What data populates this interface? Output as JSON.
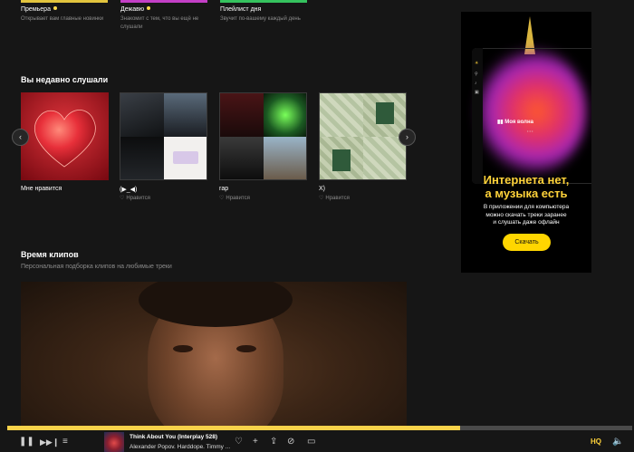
{
  "top_cards": [
    {
      "title": "Премьера",
      "subtitle": "Открывает вам главные новинки",
      "bar_color": "#ffdb4d"
    },
    {
      "title": "Дежавю",
      "subtitle": "Знакомит с тем, что вы ещё не слушали",
      "bar_color": "#d94ad8"
    },
    {
      "title": "Плейлист дня",
      "subtitle": "Звучит по-вашему каждый день",
      "bar_color": "#3fd66b"
    }
  ],
  "recent": {
    "title": "Вы недавно слушали",
    "items": [
      {
        "title": "Мне нравится",
        "like": ""
      },
      {
        "title": "(▶︎_◀)",
        "like": "Нравится"
      },
      {
        "title": "rap",
        "like": "Нравится"
      },
      {
        "title": "X)",
        "like": "Нравится"
      }
    ]
  },
  "clips": {
    "title": "Время клипов",
    "subtitle": "Персональная подборка клипов на любимые треки"
  },
  "ad": {
    "wave_label": "Моя волна",
    "headline_1": "Интернета нет,",
    "headline_2": "а музыка есть",
    "body_1": "В приложении для компьютера",
    "body_2": "можно скачать треки заранее",
    "body_3": "и слушать даже офлайн",
    "button": "Скачать"
  },
  "player": {
    "progress_fraction": 0.725,
    "track": "Think About You (Interplay 528)",
    "artist": "Alexander Popov. Harddope. Timmy ...",
    "quality": "HQ",
    "icons": {
      "pause": "pause-icon",
      "next": "next-icon",
      "queue": "queue-icon",
      "like": "heart-icon",
      "add": "plus-icon",
      "share": "share-icon",
      "menu": "more-icon",
      "block": "block-icon",
      "cast": "cast-icon",
      "volume": "volume-icon"
    }
  },
  "colors": {
    "accent": "#ffdb4d",
    "background": "#161616"
  }
}
